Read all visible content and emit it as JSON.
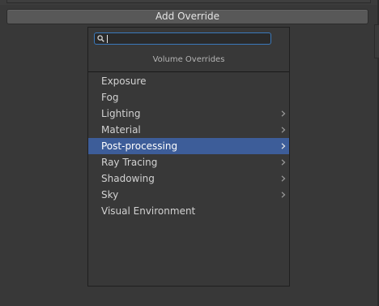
{
  "toolbar": {
    "add_override_label": "Add Override"
  },
  "popup": {
    "search": {
      "value": "",
      "placeholder": ""
    },
    "header": "Volume Overrides",
    "items": [
      {
        "label": "Exposure",
        "has_submenu": false,
        "selected": false
      },
      {
        "label": "Fog",
        "has_submenu": false,
        "selected": false
      },
      {
        "label": "Lighting",
        "has_submenu": true,
        "selected": false
      },
      {
        "label": "Material",
        "has_submenu": true,
        "selected": false
      },
      {
        "label": "Post-processing",
        "has_submenu": true,
        "selected": true
      },
      {
        "label": "Ray Tracing",
        "has_submenu": true,
        "selected": false
      },
      {
        "label": "Shadowing",
        "has_submenu": true,
        "selected": false
      },
      {
        "label": "Sky",
        "has_submenu": true,
        "selected": false
      },
      {
        "label": "Visual Environment",
        "has_submenu": false,
        "selected": false
      }
    ]
  },
  "icons": {
    "search": "search-icon",
    "submenu": "chevron-right-icon"
  },
  "colors": {
    "background": "#383838",
    "selection": "#3d5d99",
    "focus_border": "#3a79bb",
    "button": "#585858"
  }
}
